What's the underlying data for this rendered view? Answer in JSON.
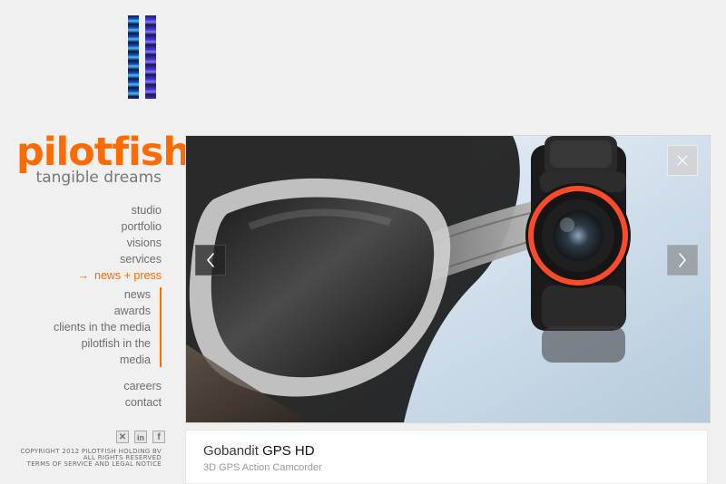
{
  "brand": {
    "wordmark": "pilotfish",
    "tagline": "tangible dreams",
    "accent_color": "#ff6b00"
  },
  "nav": {
    "items": [
      {
        "label": "studio"
      },
      {
        "label": "portfolio"
      },
      {
        "label": "visions"
      },
      {
        "label": "services"
      }
    ],
    "active": {
      "arrow": "→",
      "label": "news + press"
    },
    "subitems": [
      {
        "label": "news"
      },
      {
        "label": "awards"
      },
      {
        "label": "clients in the media"
      },
      {
        "label": "pilotfish in the"
      },
      {
        "label": "media"
      }
    ],
    "more_items": [
      {
        "label": "careers"
      },
      {
        "label": "contact"
      }
    ]
  },
  "social": {
    "xing_icon": "xing-icon",
    "linkedin_icon": "linkedin-icon",
    "facebook_icon": "facebook-icon",
    "xing_glyph": "✕",
    "linkedin_glyph": "in",
    "facebook_glyph": "f"
  },
  "legal": {
    "line1": "COPYRIGHT 2012 PILOTFISH HOLDING BV",
    "line2": "ALL RIGHTS RESERVED",
    "line3": "TERMS OF SERVICE AND LEGAL NOTICE"
  },
  "slideshow": {
    "close_icon": "close-icon",
    "prev_icon": "chevron-left-icon",
    "next_icon": "chevron-right-icon"
  },
  "caption": {
    "brand": "Gobandit",
    "model": "GPS HD",
    "subtitle": "3D GPS Action Camcorder"
  }
}
